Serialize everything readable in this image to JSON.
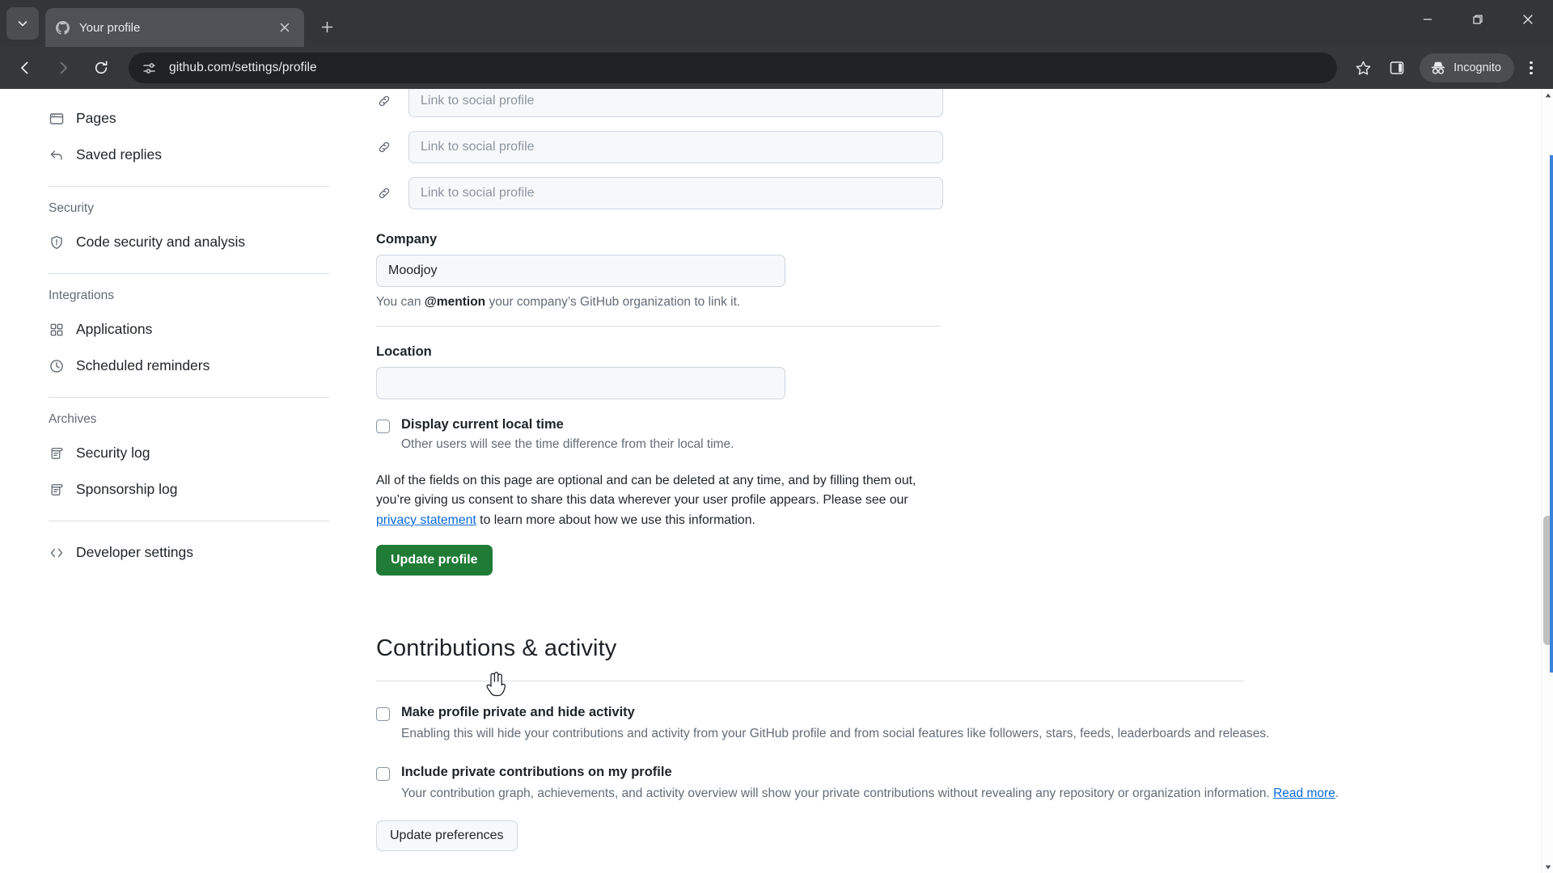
{
  "browser": {
    "tab": {
      "title": "Your profile",
      "favicon_icon": "github-mark-icon",
      "close_icon": "close-icon"
    },
    "tab_list_icon": "chevron-down-icon",
    "new_tab_icon": "plus-icon",
    "window_controls": {
      "minimize": "minimize-icon",
      "maximize": "restore-icon",
      "close": "close-icon"
    },
    "back_icon": "arrow-left-icon",
    "forward_icon": "arrow-right-icon",
    "reload_icon": "reload-icon",
    "site_info_icon": "tune-icon",
    "url": "github.com/settings/profile",
    "bookmark_icon": "star-icon",
    "side_panel_icon": "side-panel-icon",
    "incognito": {
      "label": "Incognito",
      "icon": "incognito-icon"
    },
    "menu_icon": "three-dots-vertical-icon"
  },
  "sidebar": {
    "groups": [
      {
        "heading": null,
        "items": [
          {
            "label": "Pages",
            "icon": "browser-window-icon"
          },
          {
            "label": "Saved replies",
            "icon": "reply-arrow-icon"
          }
        ]
      },
      {
        "heading": "Security",
        "items": [
          {
            "label": "Code security and analysis",
            "icon": "shield-check-icon"
          }
        ]
      },
      {
        "heading": "Integrations",
        "items": [
          {
            "label": "Applications",
            "icon": "apps-grid-icon"
          },
          {
            "label": "Scheduled reminders",
            "icon": "clock-icon"
          }
        ]
      },
      {
        "heading": "Archives",
        "items": [
          {
            "label": "Security log",
            "icon": "log-icon"
          },
          {
            "label": "Sponsorship log",
            "icon": "log-icon"
          }
        ]
      },
      {
        "heading": null,
        "items": [
          {
            "label": "Developer settings",
            "icon": "code-brackets-icon"
          }
        ]
      }
    ]
  },
  "main": {
    "social_links": [
      {
        "placeholder": "Link to social profile",
        "value": "",
        "icon": "link-icon"
      },
      {
        "placeholder": "Link to social profile",
        "value": "",
        "icon": "link-icon"
      },
      {
        "placeholder": "Link to social profile",
        "value": "",
        "icon": "link-icon"
      }
    ],
    "company": {
      "label": "Company",
      "value": "Moodjoy",
      "hint_before": "You can ",
      "hint_mention": "@mention",
      "hint_after": " your company’s GitHub organization to link it."
    },
    "location": {
      "label": "Location",
      "value": "",
      "checkbox_label": "Display current local time",
      "checkbox_sub": "Other users will see the time difference from their local time.",
      "checked": false
    },
    "consent": {
      "part1": "All of the fields on this page are optional and can be deleted at any time, and by filling them out, you’re giving us consent to share this data wherever your user profile appears. Please see our ",
      "link": "privacy statement",
      "part2": " to learn more about how we use this information."
    },
    "update_profile_label": "Update profile",
    "contributions": {
      "title": "Contributions & activity",
      "options": [
        {
          "label": "Make profile private and hide activity",
          "sub": "Enabling this will hide your contributions and activity from your GitHub profile and from social features like followers, stars, feeds, leaderboards and releases.",
          "checked": false,
          "link": null
        },
        {
          "label": "Include private contributions on my profile",
          "sub": "Your contribution graph, achievements, and activity overview will show your private contributions without revealing any repository or organization information. ",
          "checked": false,
          "link": "Read more"
        }
      ],
      "update_preferences_label": "Update preferences"
    }
  },
  "scrollbar": {
    "up_icon": "caret-up-icon",
    "down_icon": "caret-down-icon"
  },
  "colors": {
    "chrome_bg": "#323639",
    "omnibox_bg": "#202124",
    "primary_green": "#1f7b36",
    "link_blue": "#0969da",
    "focus_blue": "#3b82dd"
  }
}
